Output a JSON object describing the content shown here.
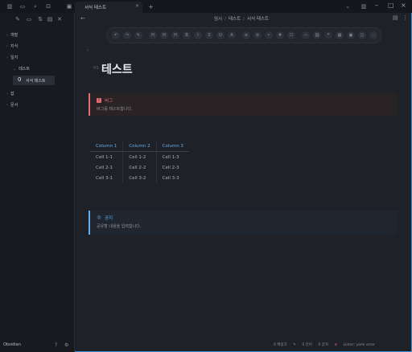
{
  "titlebar": {
    "tab_title": "서식 테스트",
    "close_glyph": "×",
    "newtab_glyph": "+",
    "min_glyph": "–",
    "max_glyph": "□",
    "close_win_glyph": "×"
  },
  "sidebar": {
    "items": [
      {
        "label": "개발",
        "chev": "›"
      },
      {
        "label": "지식",
        "chev": "›"
      },
      {
        "label": "일지",
        "chev": "›"
      },
      {
        "label": "테스트",
        "chev": "⌄"
      },
      {
        "label": "잡",
        "chev": "›"
      },
      {
        "label": "문서",
        "chev": "›"
      }
    ],
    "selected": {
      "number": "0",
      "label": "서식 테스트"
    },
    "vault_name": "Obsidian"
  },
  "editor": {
    "breadcrumb": [
      "임시",
      "테스트",
      "서식 테스트"
    ],
    "fold_glyph": "›",
    "heading_tag": "H1",
    "heading": "테스트"
  },
  "callout_bug": {
    "icon": "!",
    "title": "버그",
    "body": "버그를 테스트합니다."
  },
  "table": {
    "headers": [
      "Column 1",
      "Column 2",
      "Column 3"
    ],
    "rows": [
      [
        "Cell 1-1",
        "Cell 1-2",
        "Cell 1-3"
      ],
      [
        "Cell 2-1",
        "Cell 2-2",
        "Cell 2-3"
      ],
      [
        "Cell 3-1",
        "Cell 3-2",
        "Cell 3-3"
      ]
    ]
  },
  "callout_info": {
    "icon": "◎",
    "title": "공지",
    "body": "공유할 내용을 입력합니다."
  },
  "statusbar": {
    "items": [
      "0 백링크",
      "✎",
      "0 단어",
      "0 글자",
      "⊘"
    ],
    "error": "Linter: yaml error"
  },
  "colors": {
    "accent_blue": "#61afef",
    "bug_red": "#e06c75",
    "background": "#1e2127"
  }
}
